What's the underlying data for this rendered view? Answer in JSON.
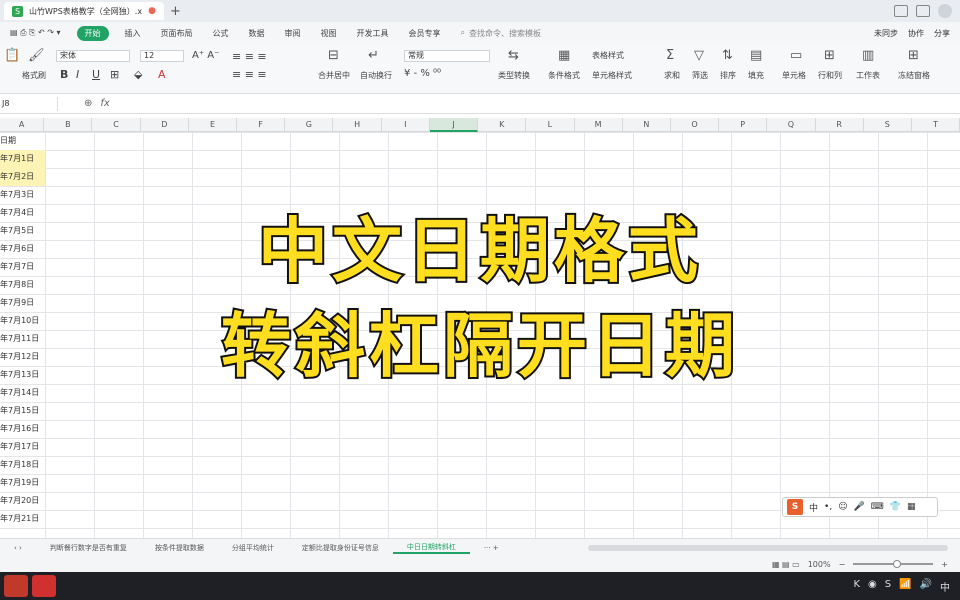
{
  "titlebar": {
    "tab_title": "山竹WPS表格教学（全网独）.xlsx",
    "new_tab": "+"
  },
  "menu": {
    "items": [
      "开始",
      "插入",
      "页面布局",
      "公式",
      "数据",
      "审阅",
      "视图",
      "开发工具",
      "会员专享"
    ],
    "active_index": 0,
    "search": "查找命令、搜索模板",
    "right": [
      "未同步",
      "协作",
      "分享"
    ]
  },
  "ribbon": {
    "font_name": "宋体",
    "font_size": "12",
    "number_format": "常规",
    "labels": [
      "格式刷",
      "合并居中",
      "自动换行",
      "类型转换",
      "条件格式",
      "表格样式",
      "单元格样式",
      "求和",
      "筛选",
      "排序",
      "填充",
      "单元格",
      "行和列",
      "工作表",
      "冻结窗格"
    ]
  },
  "formula": {
    "namebox": "J8",
    "fx": "fx"
  },
  "columns": [
    "A",
    "B",
    "C",
    "D",
    "E",
    "F",
    "G",
    "H",
    "I",
    "J",
    "K",
    "L",
    "M",
    "N",
    "O",
    "P",
    "Q",
    "R",
    "S",
    "T"
  ],
  "selected_column": "J",
  "cells": {
    "header": "日期",
    "dates": [
      "年7月1日",
      "年7月2日",
      "年7月3日",
      "年7月4日",
      "年7月5日",
      "年7月6日",
      "年7月7日",
      "年7月8日",
      "年7月9日",
      "年7月10日",
      "年7月11日",
      "年7月12日",
      "年7月13日",
      "年7月14日",
      "年7月15日",
      "年7月16日",
      "年7月17日",
      "年7月18日",
      "年7月19日",
      "年7月20日",
      "年7月21日"
    ]
  },
  "sheets": [
    "判断餐行数字是否有重复",
    "按条件提取数据",
    "分组平均统计",
    "定额比提取身份证号信息",
    "中日日期转斜杠"
  ],
  "active_sheet": 4,
  "status": {
    "zoom": "100%"
  },
  "overlay": {
    "line1": "中文日期格式",
    "line2": "转斜杠隔开日期"
  },
  "ime": {
    "logo": "S",
    "mode": "中"
  },
  "colors": {
    "accent": "#21a366",
    "overlay_fill": "#ffdd1f",
    "highlight": "#fdf3b5"
  }
}
